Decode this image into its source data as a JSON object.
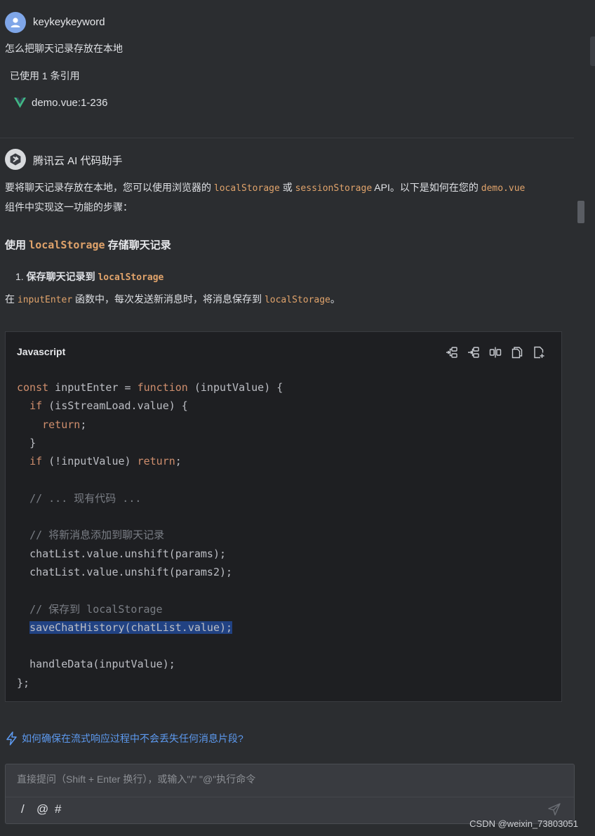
{
  "user_message": {
    "username": "keykeykeyword",
    "text": "怎么把聊天记录存放在本地",
    "reference_count": "已使用 1 条引用",
    "reference_file": "demo.vue:1-236"
  },
  "ai_message": {
    "name": "腾讯云 AI 代码助手",
    "intro_1": "要将聊天记录存放在本地，您可以使用浏览器的 ",
    "intro_code_1": "localStorage",
    "intro_2": " 或 ",
    "intro_code_2": "sessionStorage",
    "intro_3": " API。以下是如何在您的 ",
    "intro_code_3": "demo.vue",
    "intro_4": "组件中实现这一功能的步骤：",
    "heading_prefix": "使用 ",
    "heading_code": "localStorage",
    "heading_suffix": " 存储聊天记录",
    "step_number": "1.",
    "step_text": "保存聊天记录到 ",
    "step_code": "localStorage",
    "desc_1": "在 ",
    "desc_code_1": "inputEnter",
    "desc_2": " 函数中，每次发送新消息时，将消息保存到 ",
    "desc_code_2": "localStorage",
    "desc_3": "。"
  },
  "code_block": {
    "language": "Javascript",
    "tools": [
      "insert-left-icon",
      "insert-right-icon",
      "diff-icon",
      "copy-icon",
      "new-file-icon"
    ],
    "lines": {
      "l1_kw": "const",
      "l1_a": " inputEnter = ",
      "l1_kw2": "function",
      "l1_b": " (inputValue) {",
      "l2_kw": "if",
      "l2_a": " (isStreamLoad.value) {",
      "l3_kw": "return",
      "l3_a": ";",
      "l4": "}",
      "l5_kw": "if",
      "l5_a": " (!inputValue) ",
      "l5_kw2": "return",
      "l5_b": ";",
      "l7": "// ... 现有代码 ...",
      "l9": "// 将新消息添加到聊天记录",
      "l10": "chatList.value.unshift(params);",
      "l11": "chatList.value.unshift(params2);",
      "l13": "// 保存到 localStorage",
      "l14": "saveChatHistory(chatList.value);",
      "l16": "handleData(inputValue);",
      "l17": "};"
    }
  },
  "suggestion": "如何确保在流式响应过程中不会丢失任何消息片段?",
  "input": {
    "placeholder": "直接提问（Shift + Enter 换行），或输入\"/\" \"@\"执行命令",
    "cmd_slash": "/",
    "cmd_at": "@",
    "cmd_hash": "#"
  },
  "watermark": "CSDN @weixin_73803051",
  "colors": {
    "background": "#2b2d30",
    "code_background": "#1e1f22",
    "inline_code": "#e0a36b",
    "keyword": "#cf8e6d",
    "comment": "#7a7e85",
    "link": "#5d9af0",
    "vue_logo": "#41b883"
  }
}
